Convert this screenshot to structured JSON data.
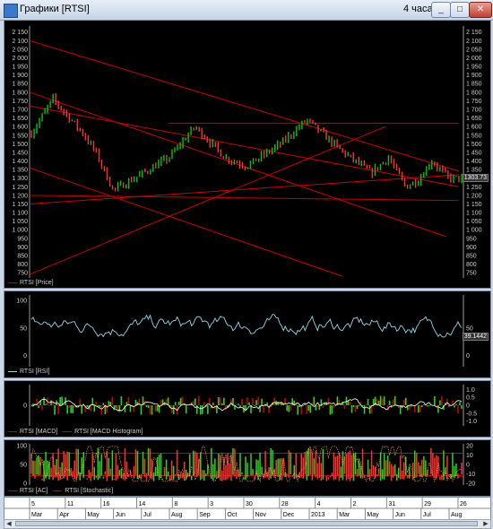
{
  "window": {
    "title": "Графики [RTSI]",
    "timeframe": "4 часа",
    "btn_min": "_",
    "btn_max": "□",
    "btn_close": "✕"
  },
  "colors": {
    "price_up": "#00c800",
    "price_down": "#ff3030",
    "trendline": "#c80000",
    "rsi": "#8fd8e8",
    "macd_line": "#ffffff",
    "macd_hist": "#c80000",
    "green_bars": "#30d020",
    "grid": "#555555"
  },
  "icons": {
    "left": "◀",
    "right": "▶"
  },
  "price_panel": {
    "legend": "RTSI [Price]",
    "current_value": "1303.73",
    "y_ticks": [
      2150,
      2100,
      2050,
      2000,
      1950,
      1900,
      1850,
      1800,
      1750,
      1700,
      1650,
      1600,
      1550,
      1500,
      1450,
      1400,
      1350,
      1300,
      1250,
      1200,
      1150,
      1100,
      1050,
      1000,
      950,
      900,
      850,
      800,
      750
    ],
    "y_min": 730,
    "y_max": 2185
  },
  "rsi_panel": {
    "legend": "RTSI [RSI]",
    "current_value": "39.1442",
    "left_ticks": [
      100,
      50,
      0
    ],
    "right_ticks": [
      50,
      0
    ],
    "y_min": -20,
    "y_max": 110
  },
  "macd_panel": {
    "legend_macd": "RTSI [MACD]",
    "legend_hist": "RTSI [MACD Histogram]",
    "left_ticks": [
      0
    ],
    "right_ticks": [
      "1.0",
      "0.5",
      "0",
      "-0.5",
      "-1.0"
    ],
    "y_min": -1.3,
    "y_max": 1.3
  },
  "stoch_panel": {
    "legend_ac": "RTSI [AC]",
    "legend_stoch": "RTSI [Stochastic]",
    "left_ticks": [
      100,
      50,
      0
    ],
    "right_ticks": [
      20,
      10,
      0,
      -10,
      -20
    ],
    "y_min": -5,
    "y_max": 105
  },
  "date_axis": {
    "days": [
      "5",
      "11",
      "16",
      "14",
      "8",
      "3",
      "30",
      "28",
      "4",
      "2",
      "31",
      "29",
      "26"
    ],
    "months": [
      "Mar",
      "Apr",
      "May",
      "Jun",
      "Jul",
      "Aug",
      "Sep",
      "Oct",
      "Nov",
      "Dec",
      "2013",
      "Mar",
      "May",
      "Jun",
      "Jul",
      "Aug"
    ]
  }
}
